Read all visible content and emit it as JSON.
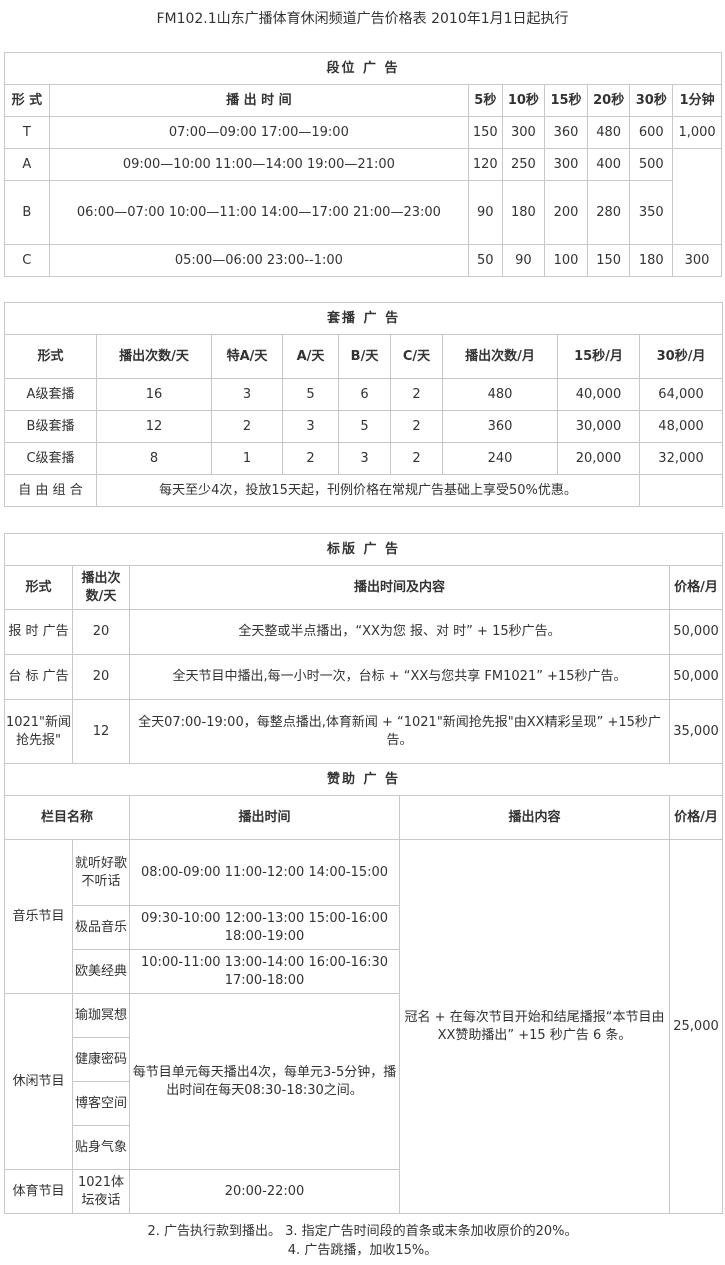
{
  "title": "FM102.1山东广播体育休闲频道广告价格表 2010年1月1日起执行",
  "t1": {
    "header": "段位 广 告",
    "cols": [
      "形 式",
      "播 出 时 间",
      "5秒",
      "10秒",
      "15秒",
      "20秒",
      "30秒",
      "1分钟"
    ],
    "rows": [
      [
        "T",
        "07:00—09:00 17:00—19:00",
        "150",
        "300",
        "360",
        "480",
        "600",
        "1,000"
      ],
      [
        "A",
        "09:00—10:00 11:00—14:00 19:00—21:00",
        "120",
        "250",
        "300",
        "400",
        "500",
        ""
      ],
      [
        "B",
        "06:00—07:00 10:00—11:00 14:00—17:00 21:00—23:00",
        "90",
        "180",
        "200",
        "280",
        "350",
        ""
      ],
      [
        "C",
        "05:00—06:00 23:00--1:00",
        "50",
        "90",
        "100",
        "150",
        "180",
        "300"
      ]
    ]
  },
  "t2": {
    "header": "套播 广 告",
    "cols": [
      "形式",
      "播出次数/天",
      "特A/天",
      "A/天",
      "B/天",
      "C/天",
      "播出次数/月",
      "15秒/月",
      "30秒/月"
    ],
    "rows": [
      [
        "A级套播",
        "16",
        "3",
        "5",
        "6",
        "2",
        "480",
        "40,000",
        "64,000"
      ],
      [
        "B级套播",
        "12",
        "2",
        "3",
        "5",
        "2",
        "360",
        "30,000",
        "48,000"
      ],
      [
        "C级套播",
        "8",
        "1",
        "2",
        "3",
        "2",
        "240",
        "20,000",
        "32,000"
      ]
    ],
    "free_label": "自 由 组 合",
    "free_text": "每天至少4次，投放15天起，刊例价格在常规广告基础上享受50%优惠。"
  },
  "t3": {
    "header": "标版 广 告",
    "cols": [
      "形式",
      "播出次数/天",
      "播出时间及内容",
      "价格/月"
    ],
    "rows": [
      [
        "报 时 广告",
        "20",
        "全天整或半点播出，“XX为您 报、对 时” + 15秒广告。",
        "50,000"
      ],
      [
        "台 标 广告",
        "20",
        "全天节目中播出,每一小时一次，台标 + “XX与您共享 FM1021” +15秒广告。",
        "50,000"
      ],
      [
        "1021\"新闻抢先报\"",
        "12",
        "全天07:00-19:00，每整点播出,体育新闻 + “1021\"新闻抢先报\"由XX精彩呈现” +15秒广告。",
        "35,000"
      ]
    ]
  },
  "t4": {
    "header": "赞助 广 告",
    "cols": [
      "栏目名称",
      "播出时间",
      "播出内容",
      "价格/月"
    ],
    "groups": [
      {
        "name": "音乐节目",
        "items": [
          {
            "sub": "就听好歌不听话",
            "time": "08:00-09:00 11:00-12:00 14:00-15:00"
          },
          {
            "sub": "极品音乐",
            "time": "09:30-10:00 12:00-13:00 15:00-16:00 18:00-19:00"
          },
          {
            "sub": "欧美经典",
            "time": "10:00-11:00 13:00-14:00 16:00-16:30 17:00-18:00"
          }
        ]
      },
      {
        "name": "休闲节目",
        "items": [
          {
            "sub": "瑜珈冥想"
          },
          {
            "sub": "健康密码"
          },
          {
            "sub": "博客空间"
          },
          {
            "sub": "贴身气象"
          }
        ],
        "time": "每节目单元每天播出4次，每单元3-5分钟，播出时间在每天08:30-18:30之间。"
      },
      {
        "name": "体育节目",
        "items": [
          {
            "sub": "1021体坛夜话",
            "time": "20:00-22:00"
          }
        ]
      }
    ],
    "content": "冠名 + 在每次节目开始和结尾播报“本节目由XX赞助播出” +15 秒广告 6 条。",
    "price": "25,000"
  },
  "footer": {
    "line1": "2. 广告执行款到播出。 3. 指定广告时间段的首条或末条加收原价的20%。",
    "line2": "4. 广告跳播，加收15%。"
  }
}
